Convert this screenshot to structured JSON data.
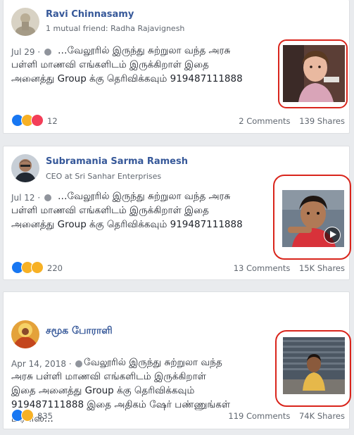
{
  "posts": [
    {
      "author": "Ravi Chinnasamy",
      "subtitle": "1 mutual friend: Radha Rajavignesh",
      "date": "Jul 29",
      "text_lines": [
        "…வேலூரில் இருந்து சுற்றுலா வந்த அரசு",
        "பள்ளி மாணவி எங்களிடம் இருக்கிறாள் இதை",
        "அனைத்து Group க்கு தெரிவிக்கவும் 919487111888"
      ],
      "reactions": [
        "like",
        "sad",
        "love"
      ],
      "reaction_count": "12",
      "comments": "2 Comments",
      "shares": "139 Shares"
    },
    {
      "author": "Subramania Sarma Ramesh",
      "subtitle": "CEO at Sri Sanhar Enterprises",
      "date": "Jul 12",
      "text_lines": [
        "…வேலூரில் இருந்து சுற்றுலா வந்த அரசு",
        "பள்ளி மாணவி எங்களிடம் இருக்கிறாள் இதை",
        "அனைத்து Group க்கு தெரிவிக்கவும் 919487111888"
      ],
      "reactions": [
        "like",
        "sad",
        "wow"
      ],
      "reaction_count": "220",
      "comments": "13 Comments",
      "shares": "15K Shares"
    },
    {
      "author": "சமூக போராளி",
      "subtitle": "",
      "date": "Apr 14, 2018",
      "text_lines": [
        "வேலூரில் இருந்து சுற்றுலா வந்த",
        "அரசு பள்ளி மாணவி எங்களிடம் இருக்கிறாள்",
        "இதை அனைத்து Group க்கு தெரிவிக்கவும்",
        "919487111888 இதை அதிகம் ஷேர் பண்ணுங்கள்",
        "பிரன்ஸ்..."
      ],
      "reactions": [
        "like",
        "sad"
      ],
      "reaction_count": "835",
      "comments": "119 Comments",
      "shares": "74K Shares"
    }
  ],
  "colors": {
    "author": "#365899",
    "highlight_ring": "#d9251c",
    "like": "#1877f2",
    "sad": "#f7b125",
    "love": "#f33e58"
  },
  "icons": [
    "globe-icon",
    "like-reaction-icon",
    "sad-reaction-icon",
    "love-reaction-icon",
    "wow-reaction-icon",
    "play-icon"
  ]
}
